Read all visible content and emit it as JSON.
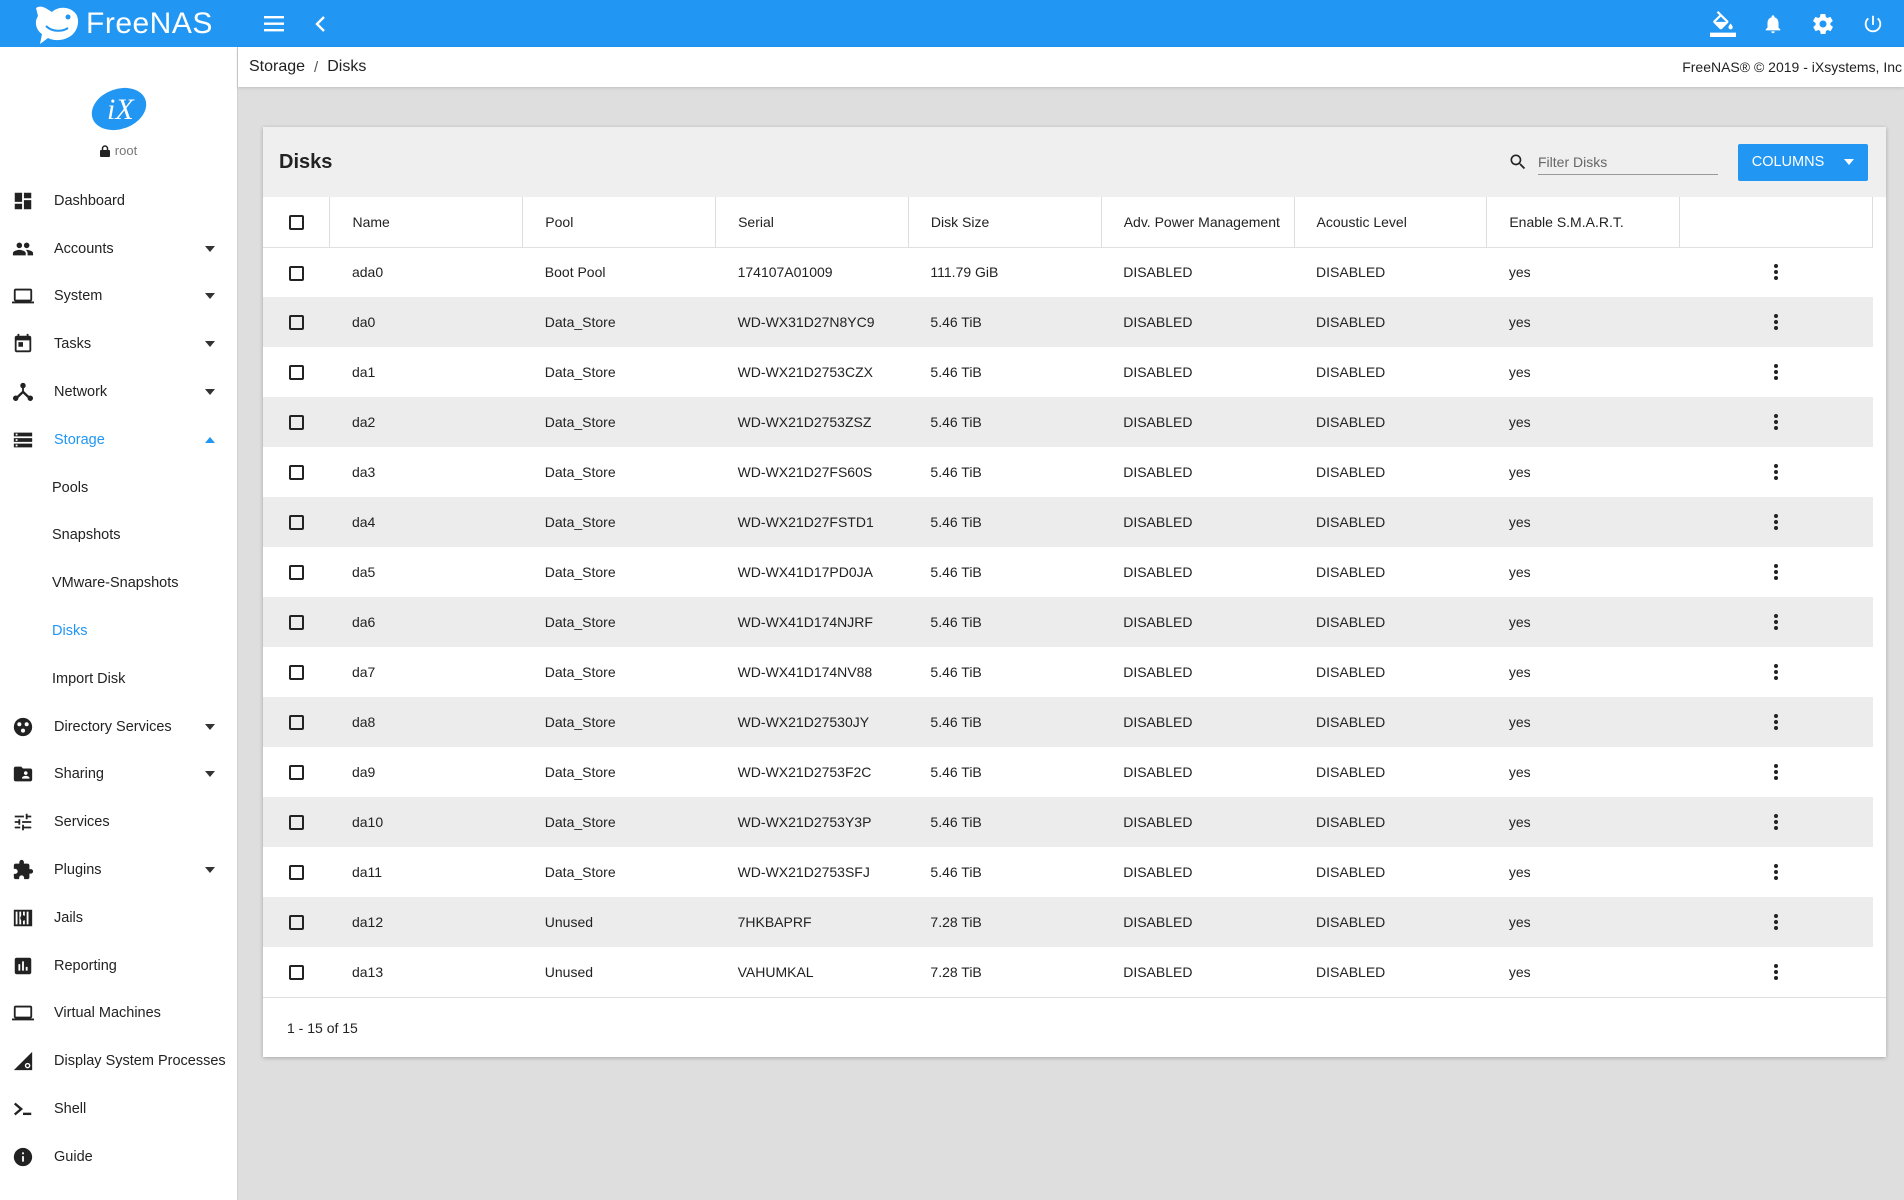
{
  "app": {
    "brand": "FreeNAS",
    "accent_color": "#2196f3"
  },
  "topbar": {
    "left_icons": [
      "menu-icon",
      "chevron-left-icon"
    ],
    "right_icons": [
      "paint-bucket-icon",
      "bell-icon",
      "gear-icon",
      "power-icon"
    ]
  },
  "sidebar": {
    "user": "root",
    "items": [
      {
        "label": "Dashboard",
        "icon": "dashboard-icon",
        "caret": false
      },
      {
        "label": "Accounts",
        "icon": "people-icon",
        "caret": true
      },
      {
        "label": "System",
        "icon": "laptop-icon",
        "caret": true
      },
      {
        "label": "Tasks",
        "icon": "calendar-icon",
        "caret": true
      },
      {
        "label": "Network",
        "icon": "network-icon",
        "caret": true
      },
      {
        "label": "Storage",
        "icon": "storage-icon",
        "caret": true,
        "expanded": true,
        "active": true
      },
      {
        "label": "Directory Services",
        "icon": "directory-icon",
        "caret": true
      },
      {
        "label": "Sharing",
        "icon": "folder-shared-icon",
        "caret": true
      },
      {
        "label": "Services",
        "icon": "tune-icon",
        "caret": false
      },
      {
        "label": "Plugins",
        "icon": "puzzle-icon",
        "caret": true
      },
      {
        "label": "Jails",
        "icon": "jail-icon",
        "caret": false
      },
      {
        "label": "Reporting",
        "icon": "chart-icon",
        "caret": false
      },
      {
        "label": "Virtual Machines",
        "icon": "computer-icon",
        "caret": false
      },
      {
        "label": "Display System Processes",
        "icon": "processes-icon",
        "caret": false
      },
      {
        "label": "Shell",
        "icon": "shell-icon",
        "caret": false
      },
      {
        "label": "Guide",
        "icon": "info-icon",
        "caret": false
      }
    ],
    "storage_subitems": [
      "Pools",
      "Snapshots",
      "VMware-Snapshots",
      "Disks",
      "Import Disk"
    ],
    "active_subitem": "Disks"
  },
  "breadcrumb": {
    "items": [
      "Storage",
      "Disks"
    ],
    "separator": "/",
    "copyright": "FreeNAS® © 2019 - iXsystems, Inc"
  },
  "card": {
    "title": "Disks",
    "filter_placeholder": "Filter Disks",
    "columns_button": "COLUMNS",
    "footer": "1 - 15 of 15"
  },
  "table": {
    "headers": [
      "Name",
      "Pool",
      "Serial",
      "Disk Size",
      "Adv. Power Management",
      "Acoustic Level",
      "Enable S.M.A.R.T."
    ],
    "rows": [
      [
        "ada0",
        "Boot Pool",
        "174107A01009",
        "111.79 GiB",
        "DISABLED",
        "DISABLED",
        "yes"
      ],
      [
        "da0",
        "Data_Store",
        "WD-WX31D27N8YC9",
        "5.46 TiB",
        "DISABLED",
        "DISABLED",
        "yes"
      ],
      [
        "da1",
        "Data_Store",
        "WD-WX21D2753CZX",
        "5.46 TiB",
        "DISABLED",
        "DISABLED",
        "yes"
      ],
      [
        "da2",
        "Data_Store",
        "WD-WX21D2753ZSZ",
        "5.46 TiB",
        "DISABLED",
        "DISABLED",
        "yes"
      ],
      [
        "da3",
        "Data_Store",
        "WD-WX21D27FS60S",
        "5.46 TiB",
        "DISABLED",
        "DISABLED",
        "yes"
      ],
      [
        "da4",
        "Data_Store",
        "WD-WX21D27FSTD1",
        "5.46 TiB",
        "DISABLED",
        "DISABLED",
        "yes"
      ],
      [
        "da5",
        "Data_Store",
        "WD-WX41D17PD0JA",
        "5.46 TiB",
        "DISABLED",
        "DISABLED",
        "yes"
      ],
      [
        "da6",
        "Data_Store",
        "WD-WX41D174NJRF",
        "5.46 TiB",
        "DISABLED",
        "DISABLED",
        "yes"
      ],
      [
        "da7",
        "Data_Store",
        "WD-WX41D174NV88",
        "5.46 TiB",
        "DISABLED",
        "DISABLED",
        "yes"
      ],
      [
        "da8",
        "Data_Store",
        "WD-WX21D27530JY",
        "5.46 TiB",
        "DISABLED",
        "DISABLED",
        "yes"
      ],
      [
        "da9",
        "Data_Store",
        "WD-WX21D2753F2C",
        "5.46 TiB",
        "DISABLED",
        "DISABLED",
        "yes"
      ],
      [
        "da10",
        "Data_Store",
        "WD-WX21D2753Y3P",
        "5.46 TiB",
        "DISABLED",
        "DISABLED",
        "yes"
      ],
      [
        "da11",
        "Data_Store",
        "WD-WX21D2753SFJ",
        "5.46 TiB",
        "DISABLED",
        "DISABLED",
        "yes"
      ],
      [
        "da12",
        "Unused",
        "7HKBAPRF",
        "7.28 TiB",
        "DISABLED",
        "DISABLED",
        "yes"
      ],
      [
        "da13",
        "Unused",
        "VAHUMKAL",
        "7.28 TiB",
        "DISABLED",
        "DISABLED",
        "yes"
      ]
    ]
  }
}
